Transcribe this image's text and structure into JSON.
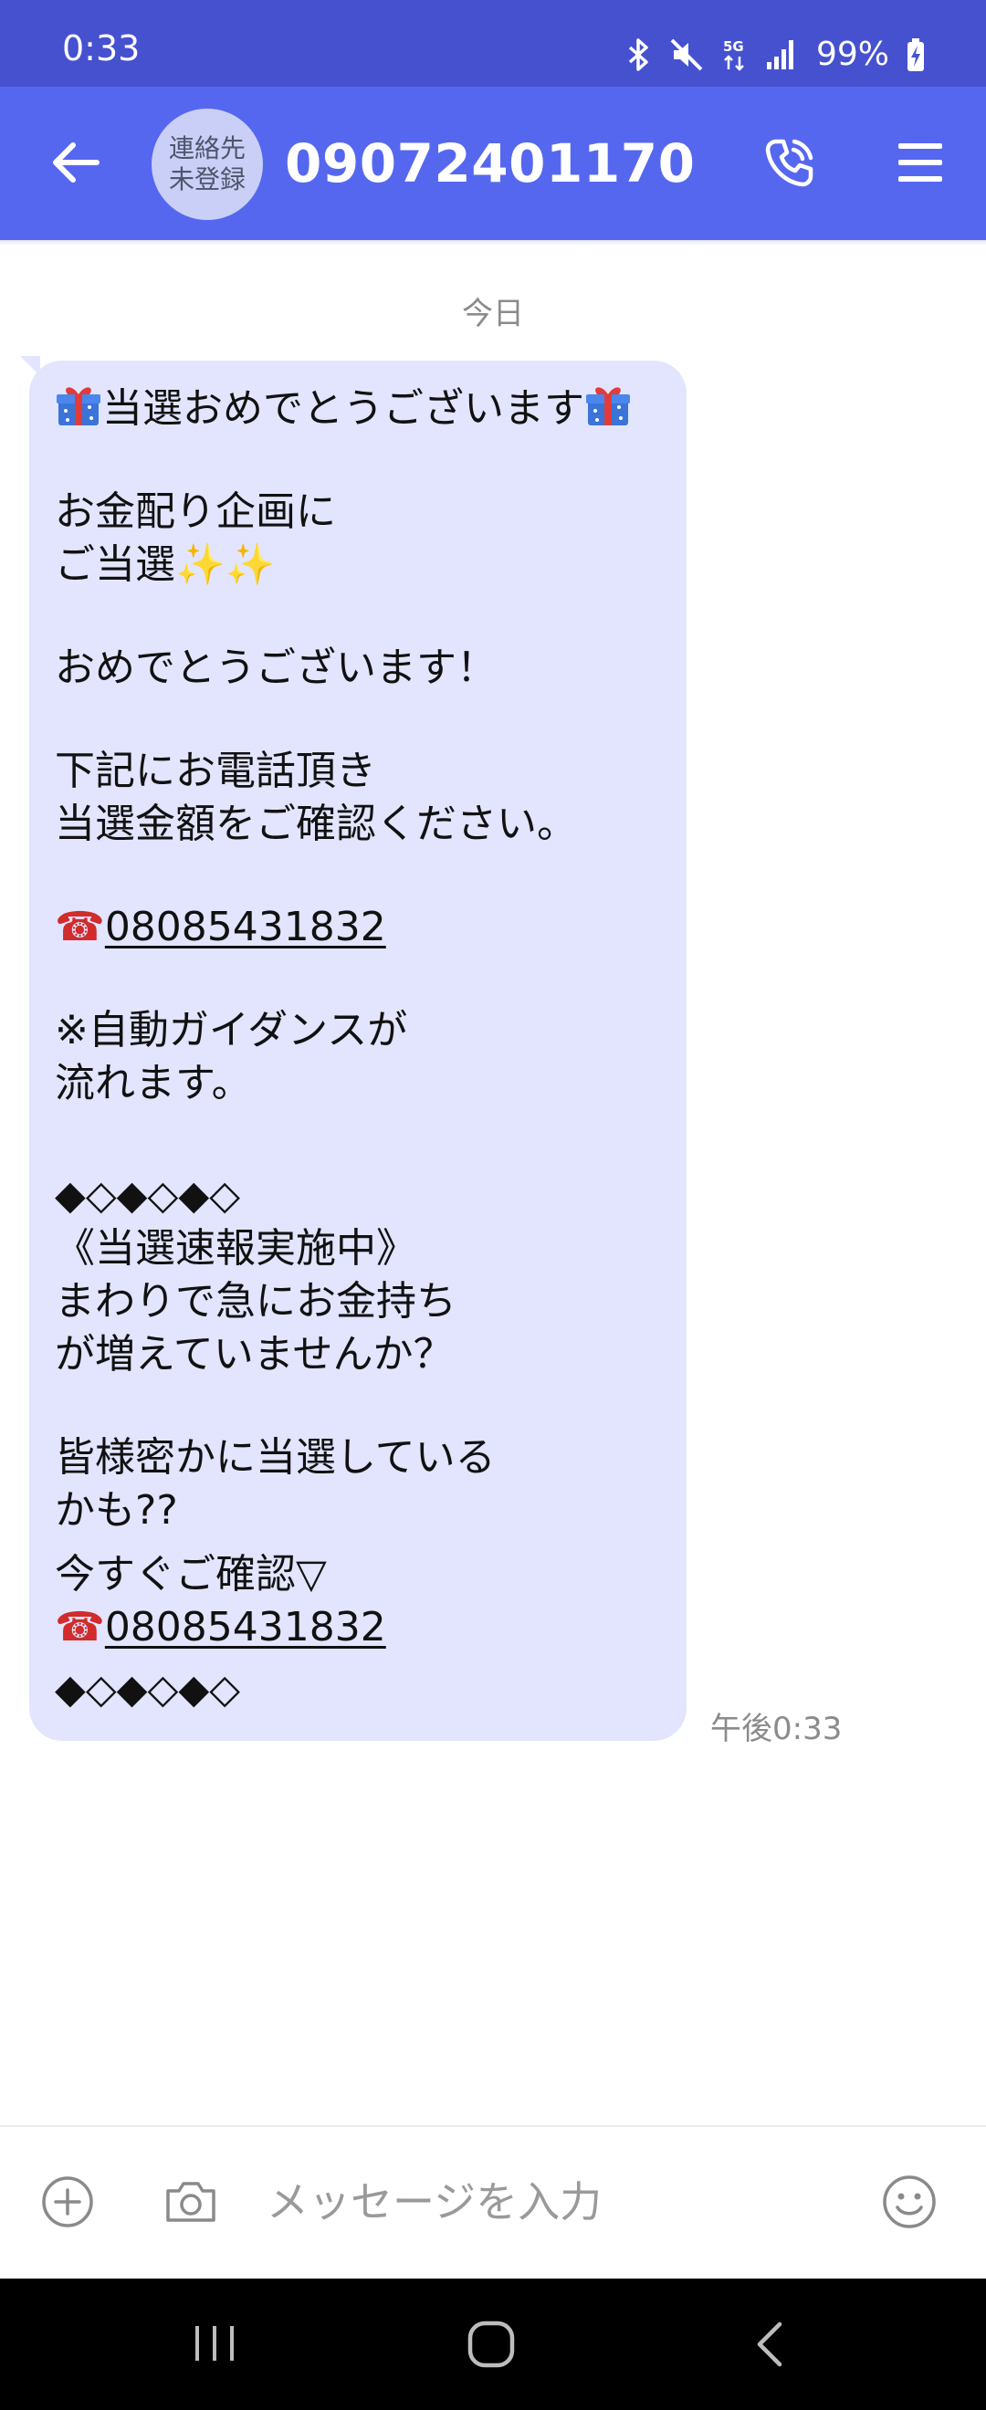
{
  "status_bar": {
    "time": "0:33",
    "network": "5G",
    "battery": "99%"
  },
  "header": {
    "avatar_line1": "連絡先",
    "avatar_line2": "未登録",
    "title": "09072401170"
  },
  "conversation": {
    "date_label": "今日",
    "message": {
      "line_01": "当選おめでとうございます",
      "line_02": "お金配り企画に",
      "line_03": "ご当選",
      "line_03_emoji": "✨✨",
      "line_04": "おめでとうございます！",
      "line_05": "下記にお電話頂き",
      "line_06": "当選金額をご確認ください。",
      "phone_icon": "☎",
      "phone_1": "08085431832",
      "line_07": "※自動ガイダンスが",
      "line_08": "流れます。",
      "line_09": "◆◇◆◇◆◇",
      "line_10": "《当選速報実施中》",
      "line_11": "まわりで急にお金持ち",
      "line_12": "が増えていませんか？",
      "line_13": "皆様密かに当選している",
      "line_14": "かも??",
      "line_15": "今すぐご確認▽",
      "phone_2": "08085431832",
      "line_16": "◆◇◆◇◆◇"
    },
    "timestamp": "午後0:33"
  },
  "input_bar": {
    "placeholder": "メッセージを入力"
  },
  "colors": {
    "status_bar": "#4651cf",
    "header": "#5667ef",
    "bubble": "#e2e5fd",
    "nav_bar": "#000000"
  },
  "icons": {
    "back": "arrow-left-icon",
    "call": "phone-call-icon",
    "menu": "hamburger-menu-icon",
    "add": "plus-circle-icon",
    "camera": "camera-icon",
    "emoji": "smiley-icon",
    "gift": "gift-icon"
  }
}
